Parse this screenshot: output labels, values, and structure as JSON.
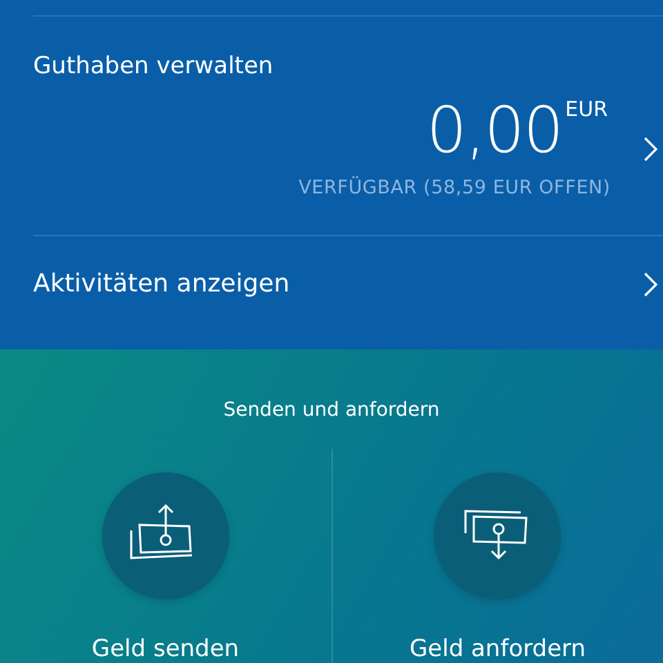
{
  "balance": {
    "title": "Guthaben verwalten",
    "amount": "0,00",
    "currency": "EUR",
    "available": "VERFÜGBAR (58,59 EUR OFFEN)"
  },
  "activity": {
    "label": "Aktivitäten anzeigen"
  },
  "transfer": {
    "heading": "Senden und anfordern",
    "actions": [
      {
        "kind": "send",
        "label": "Geld senden"
      },
      {
        "kind": "request",
        "label": "Geld anfordern"
      }
    ]
  }
}
